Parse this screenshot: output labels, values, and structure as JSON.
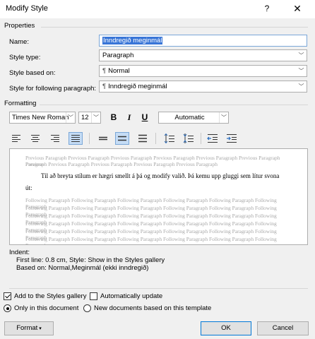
{
  "titlebar": {
    "title": "Modify Style",
    "help": "?",
    "close": "✕"
  },
  "properties": {
    "heading": "Properties",
    "name_label": "Name:",
    "name_value": "Inndregið meginmál",
    "style_type_label": "Style type:",
    "style_type_value": "Paragraph",
    "based_on_label": "Style based on:",
    "based_on_value": "Normal",
    "following_label": "Style for following paragraph:",
    "following_value": "Inndregið meginmál"
  },
  "formatting": {
    "heading": "Formatting",
    "font": "Times New Roman",
    "size": "12",
    "bold": "B",
    "italic": "I",
    "underline": "U",
    "color": "Automatic"
  },
  "preview": {
    "previous_lines": [
      "Previous Paragraph Previous Paragraph Previous Paragraph Previous Paragraph Previous Paragraph Previous Paragraph Previous",
      "Paragraph Previous Paragraph Previous Paragraph Previous Paragraph Previous Paragraph"
    ],
    "main_line_1": "Til að breyta stílum er hægri smellt á þá og modify valið. Þá kemu upp gluggi sem lítur svona",
    "main_line_2": "út:",
    "following_lines": [
      "Following Paragraph Following Paragraph Following Paragraph Following Paragraph Following Paragraph Following Paragraph",
      "Following Paragraph Following Paragraph Following Paragraph Following Paragraph Following Paragraph Following Paragraph",
      "Following Paragraph Following Paragraph Following Paragraph Following Paragraph Following Paragraph Following Paragraph",
      "Following Paragraph Following Paragraph Following Paragraph Following Paragraph Following Paragraph Following Paragraph",
      "Following Paragraph Following Paragraph Following Paragraph Following Paragraph Following Paragraph Following Paragraph",
      "Following Paragraph Following Paragraph Following Paragraph Following Paragraph Following Paragraph Following Paragraph"
    ]
  },
  "description": {
    "line1": "Indent:",
    "line2": "First line:  0.8 cm, Style: Show in the Styles gallery",
    "line3": "Based on: Normal,Meginmál (ekki inndregið)"
  },
  "options": {
    "add_to_gallery": "Add to the Styles gallery",
    "add_to_gallery_checked": true,
    "auto_update": "Automatically update",
    "auto_update_checked": false,
    "only_this_doc": "Only in this document",
    "new_docs": "New documents based on this template",
    "selected_scope": "only_this_doc"
  },
  "buttons": {
    "format": "Format",
    "ok": "OK",
    "cancel": "Cancel"
  },
  "colors": {
    "accent": "#0078d7",
    "selection": "#3875d7",
    "active_toggle": "#c5dcf5"
  }
}
